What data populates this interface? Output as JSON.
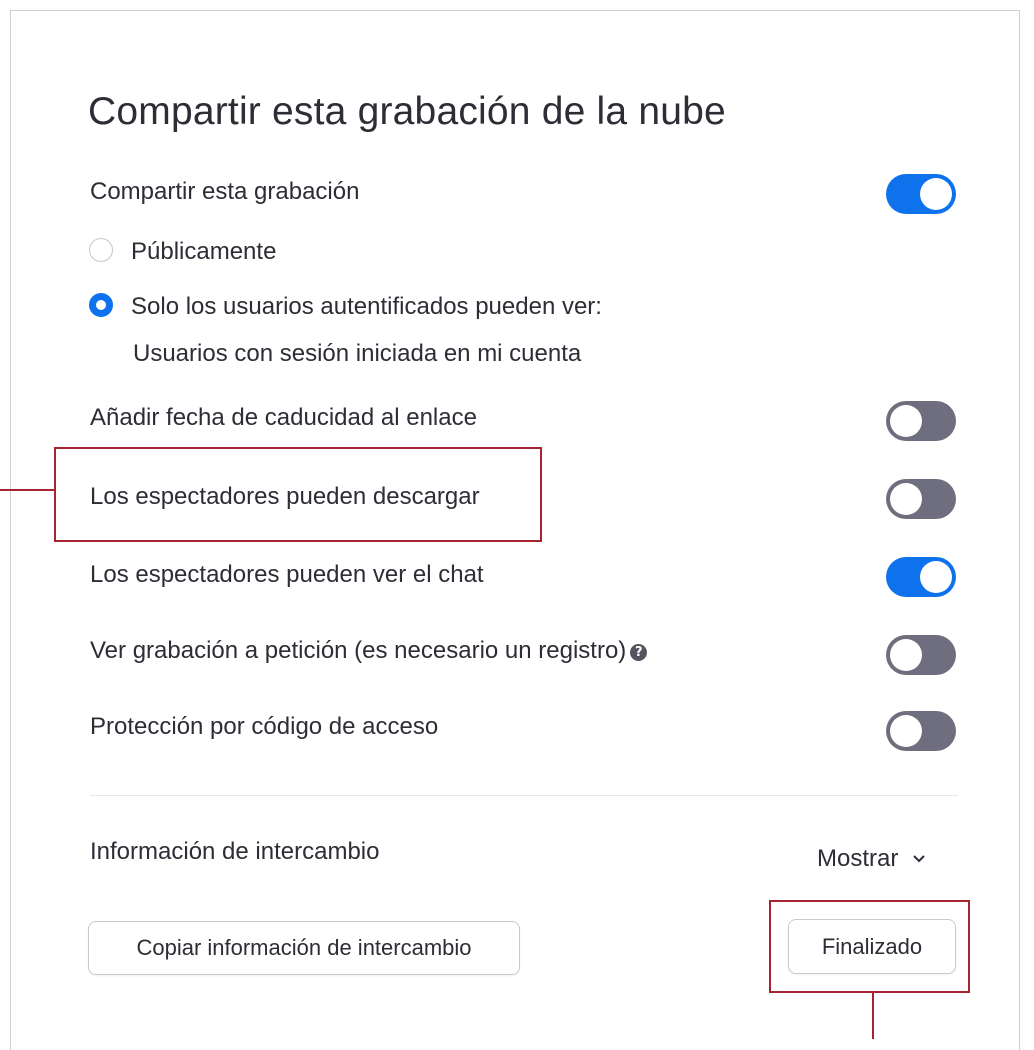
{
  "dialog": {
    "title": "Compartir esta grabación de la nube"
  },
  "share": {
    "label": "Compartir esta grabación",
    "enabled": true
  },
  "visibility": {
    "public_label": "Públicamente",
    "public_selected": false,
    "auth_label": "Solo los usuarios autentificados pueden ver:",
    "auth_selected": true,
    "auth_detail": "Usuarios con sesión iniciada en mi cuenta"
  },
  "options": [
    {
      "label": "Añadir fecha de caducidad al enlace",
      "enabled": false
    },
    {
      "label": "Los espectadores pueden descargar",
      "enabled": false
    },
    {
      "label": "Los espectadores pueden ver el chat",
      "enabled": true
    },
    {
      "label": "Ver grabación a petición (es necesario un registro)",
      "enabled": false,
      "help_icon": "question-circle-icon"
    },
    {
      "label": "Protección por código de acceso",
      "enabled": false
    }
  ],
  "sharing_info": {
    "label": "Información de intercambio",
    "show_label": "Mostrar",
    "show_icon": "chevron-down-icon"
  },
  "buttons": {
    "copy_label": "Copiar información de intercambio",
    "done_label": "Finalizado"
  },
  "colors": {
    "toggle_on": "#0e72ed",
    "toggle_off": "#6e6e7e",
    "highlight": "#a4252f"
  }
}
